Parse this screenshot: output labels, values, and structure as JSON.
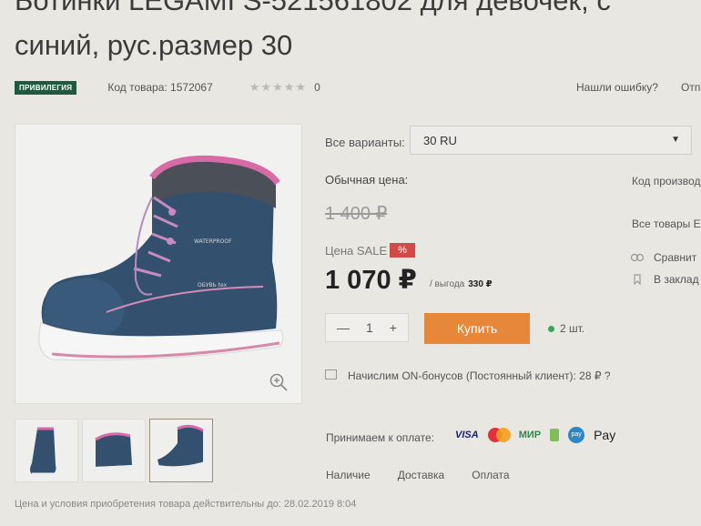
{
  "product": {
    "title_line1_cut": "Ботинки LEGAMI S-521561802 для девочек, с",
    "title_line2": "синий, рус.размер 30"
  },
  "meta": {
    "badge": "ПРИВИЛЕГИЯ",
    "sku": "Код товара: 1572067",
    "stars": "★★★★★",
    "rating_count": "0",
    "report_error": "Нашли ошибку?",
    "report_cut": "Отп"
  },
  "variants": {
    "label": "Все варианты:",
    "selected": "30 RU"
  },
  "pricing": {
    "regular_label": "Обычная цена:",
    "old_price": "1 400 ₽",
    "sale_label": "Цена SALE",
    "sale_badge": "%",
    "price": "1 070 ₽",
    "savings_prefix": "/   выгода",
    "savings_value": "330 ₽"
  },
  "purchase": {
    "qty_minus": "—",
    "qty_value": "1",
    "qty_plus": "+",
    "buy_label": "Купить",
    "stock": "2 шт."
  },
  "bonus": {
    "text": "Начислим ON-бонусов (Постоянный клиент): 28 ₽ ?"
  },
  "payment": {
    "label": "Принимаем к оплате:",
    "visa": "VISA",
    "mir": "МИР",
    "apay_text": "pay",
    "apple_pay": " Pay"
  },
  "tabs": [
    "Наличие",
    "Доставка",
    "Оплата"
  ],
  "terms": "Цена и условия приобретения товара действительны до: 28.02.2019 8:04",
  "side": {
    "manufacturer_code": "Код производ",
    "all_goods": "Все товары Е",
    "compare": "Сравнит",
    "bookmarks": "В заклад"
  },
  "colors": {
    "buy_button": "#e6873a",
    "badge": "#1f5a40",
    "sale_badge": "#d14a4a",
    "stock_dot": "#3aa55a"
  }
}
